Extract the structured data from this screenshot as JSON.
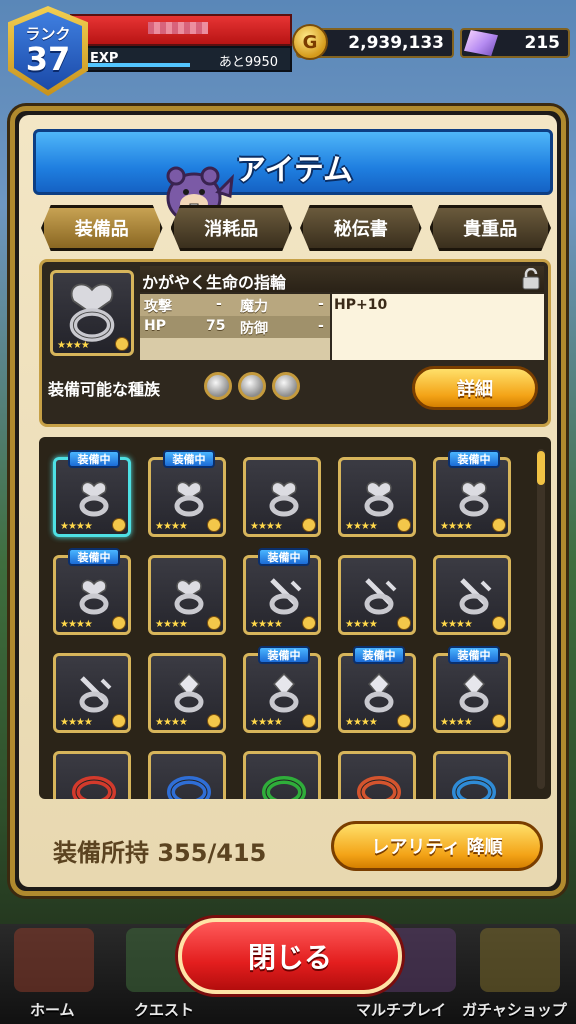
{
  "hud": {
    "rank_label": "ランク",
    "rank_value": "37",
    "exp_label": "EXP",
    "exp_remaining": "あと9950",
    "exp_progress": 0.55,
    "gold": "2,939,133",
    "gold_icon_letter": "G",
    "gems": "215"
  },
  "panel": {
    "title": "アイテム",
    "tabs": [
      {
        "label": "装備品",
        "active": true
      },
      {
        "label": "消耗品",
        "active": false
      },
      {
        "label": "秘伝書",
        "active": false
      },
      {
        "label": "貴重品",
        "active": false
      }
    ]
  },
  "detail": {
    "name": "かがやく生命の指輪",
    "stats": [
      {
        "k": "攻撃",
        "v": "-"
      },
      {
        "k": "魔力",
        "v": "-"
      },
      {
        "k": "HP",
        "v": "75"
      },
      {
        "k": "防御",
        "v": "-"
      }
    ],
    "note": "HP+10",
    "stars": "★★★★",
    "races_label": "装備可能な種族",
    "detail_button": "詳細"
  },
  "grid": {
    "badge_label": "装備中",
    "items": [
      {
        "type": "heart",
        "equipped": true,
        "selected": true,
        "stars": "★★★★",
        "color": "#c9c9cf"
      },
      {
        "type": "heart",
        "equipped": true,
        "selected": false,
        "stars": "★★★★",
        "color": "#c9c9cf"
      },
      {
        "type": "heart",
        "equipped": false,
        "selected": false,
        "stars": "★★★★",
        "color": "#c9c9cf"
      },
      {
        "type": "heart",
        "equipped": false,
        "selected": false,
        "stars": "★★★★",
        "color": "#c9c9cf"
      },
      {
        "type": "heart",
        "equipped": true,
        "selected": false,
        "stars": "★★★★",
        "color": "#c9c9cf"
      },
      {
        "type": "heart",
        "equipped": true,
        "selected": false,
        "stars": "★★★★",
        "color": "#c9c9cf"
      },
      {
        "type": "heart",
        "equipped": false,
        "selected": false,
        "stars": "★★★★",
        "color": "#c9c9cf"
      },
      {
        "type": "cross",
        "equipped": true,
        "selected": false,
        "stars": "★★★★",
        "color": "#c9c9cf"
      },
      {
        "type": "cross",
        "equipped": false,
        "selected": false,
        "stars": "★★★★",
        "color": "#c9c9cf"
      },
      {
        "type": "cross",
        "equipped": false,
        "selected": false,
        "stars": "★★★★",
        "color": "#c9c9cf"
      },
      {
        "type": "cross",
        "equipped": false,
        "selected": false,
        "stars": "★★★★",
        "color": "#c9c9cf"
      },
      {
        "type": "gem",
        "equipped": false,
        "selected": false,
        "stars": "★★★★",
        "color": "#c9c9cf"
      },
      {
        "type": "gem",
        "equipped": true,
        "selected": false,
        "stars": "★★★★",
        "color": "#c9c9cf"
      },
      {
        "type": "gem",
        "equipped": true,
        "selected": false,
        "stars": "★★★★",
        "color": "#c9c9cf"
      },
      {
        "type": "gem",
        "equipped": true,
        "selected": false,
        "stars": "★★★★",
        "color": "#c9c9cf"
      },
      {
        "type": "band",
        "equipped": false,
        "selected": false,
        "stars": "",
        "color": "#d33a2c"
      },
      {
        "type": "band",
        "equipped": false,
        "selected": false,
        "stars": "",
        "color": "#2f6ed6"
      },
      {
        "type": "band",
        "equipped": false,
        "selected": false,
        "stars": "",
        "color": "#2fae3a"
      },
      {
        "type": "band",
        "equipped": false,
        "selected": false,
        "stars": "",
        "color": "#d4542e"
      },
      {
        "type": "band",
        "equipped": false,
        "selected": false,
        "stars": "",
        "color": "#2f8bd6"
      }
    ]
  },
  "footer": {
    "count_label": "装備所持 355/415",
    "sort_button": "レアリティ 降順"
  },
  "close_button": "閉じる",
  "nav": [
    {
      "label": "ホーム"
    },
    {
      "label": "クエスト"
    },
    {
      "label": "マルチプレイ"
    },
    {
      "label": "ガチャショップ"
    }
  ],
  "colors": {
    "equipped_badge": "#1b6bd6",
    "selected_border": "#4ee0e4",
    "close_button": "#e31e1e",
    "accent_gold": "#f3a317"
  }
}
